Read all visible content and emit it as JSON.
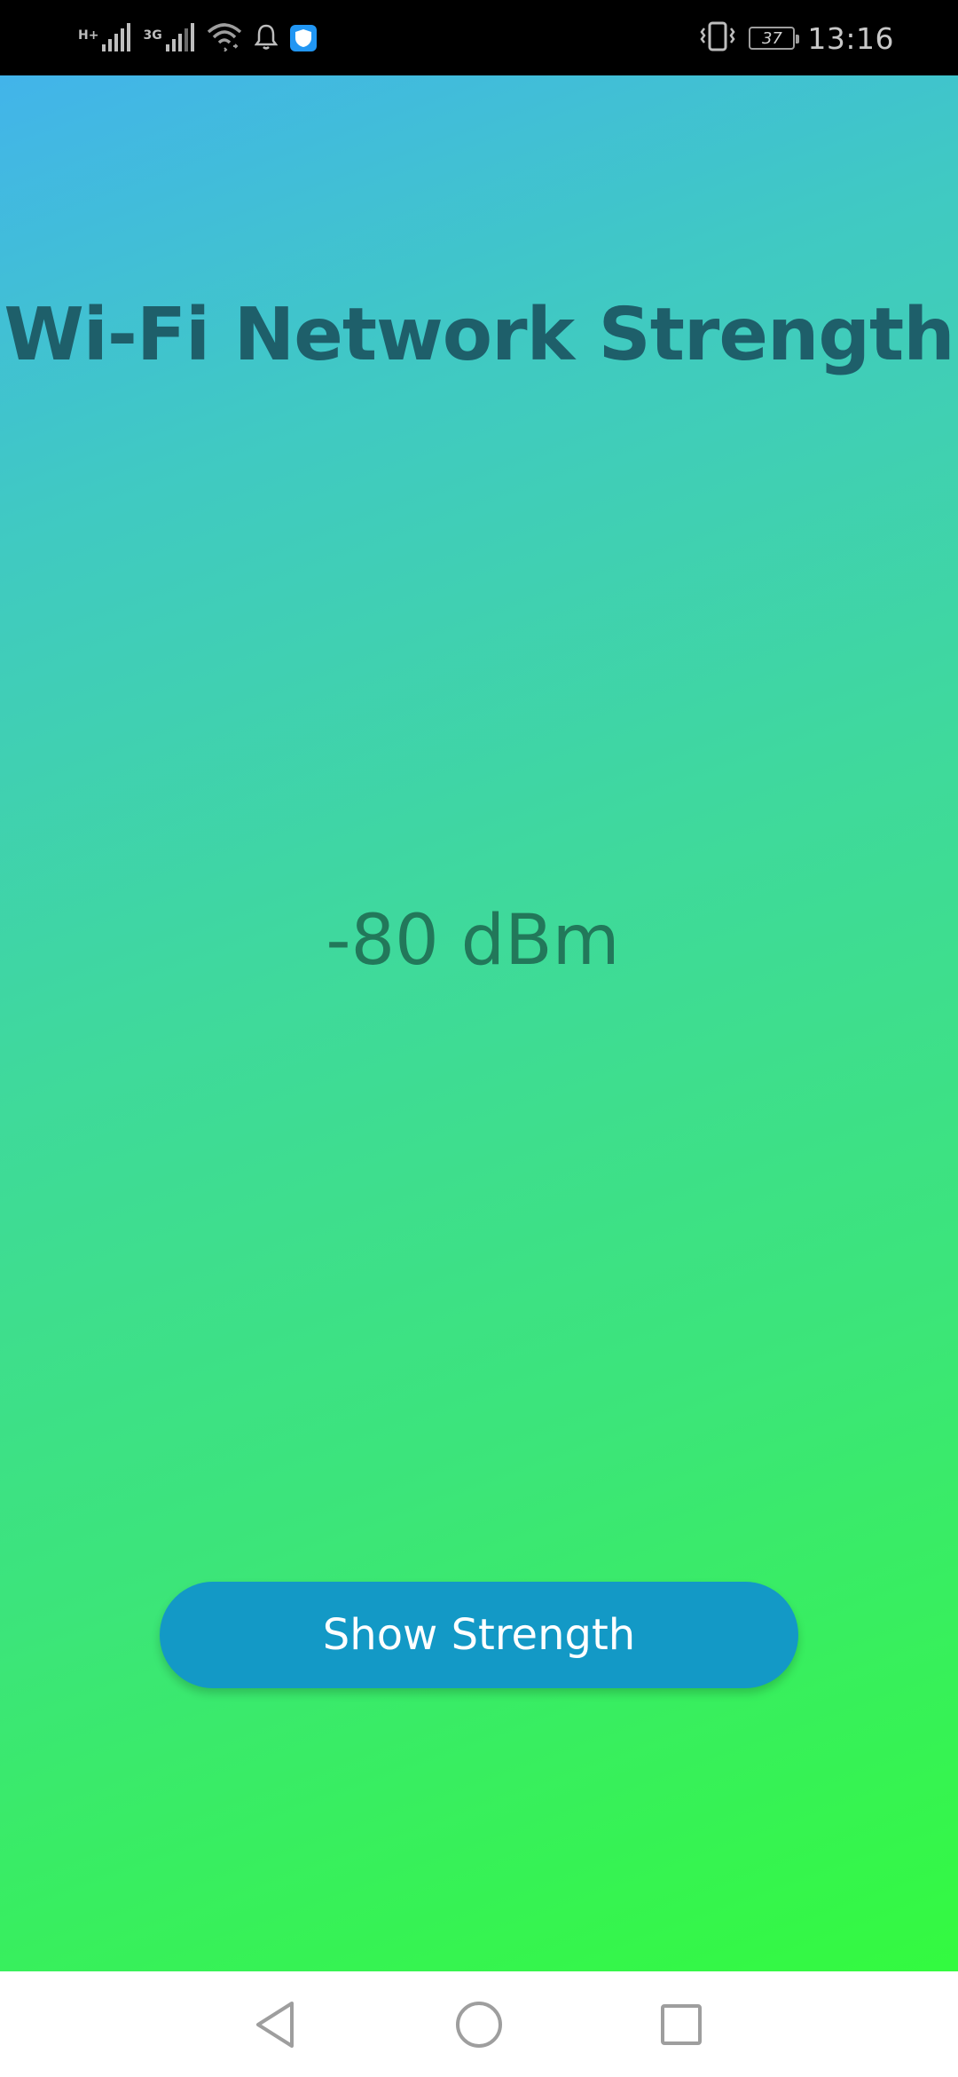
{
  "status_bar": {
    "network_type_1": "H+",
    "network_type_2": "3G",
    "battery_level": "37",
    "time": "13:16",
    "icons": [
      "signal-h-plus-icon",
      "signal-3g-icon",
      "wifi-icon",
      "notification-bell-icon",
      "shield-app-icon",
      "vibrate-icon",
      "battery-icon"
    ]
  },
  "main": {
    "title": "Wi-Fi Network Strength",
    "strength_value": "-80 dBm",
    "button_label": "Show Strength"
  },
  "nav_bar": {
    "icons": [
      "back-icon",
      "home-icon",
      "recents-icon"
    ]
  },
  "colors": {
    "gradient_top": "#42b4ea",
    "gradient_bottom": "#33fa3f",
    "title": "#1e5f6a",
    "value": "#22785a",
    "button": "#1399c6",
    "button_text": "#ffffff"
  }
}
